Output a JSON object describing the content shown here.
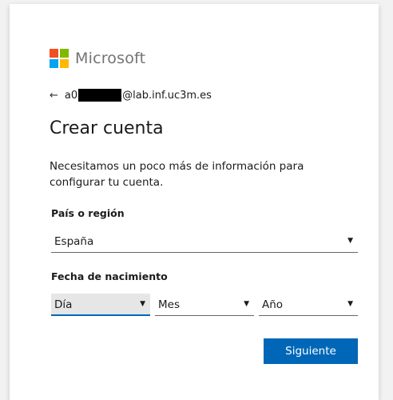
{
  "brand": {
    "name": "Microsoft",
    "logo_colors": [
      "#f25022",
      "#7fba00",
      "#00a4ef",
      "#ffb900"
    ]
  },
  "identity": {
    "back_icon": "arrow-left-icon",
    "email_prefix": "a0",
    "email_suffix": "@lab.inf.uc3m.es"
  },
  "page": {
    "title": "Crear cuenta",
    "description": "Necesitamos un poco más de información para configurar tu cuenta."
  },
  "country": {
    "label": "País o región",
    "value": "España"
  },
  "birthdate": {
    "label": "Fecha de nacimiento",
    "day_value": "Día",
    "month_value": "Mes",
    "year_value": "Año"
  },
  "actions": {
    "next_label": "Siguiente"
  },
  "colors": {
    "accent": "#0067b8",
    "text": "#1b1b1b"
  }
}
